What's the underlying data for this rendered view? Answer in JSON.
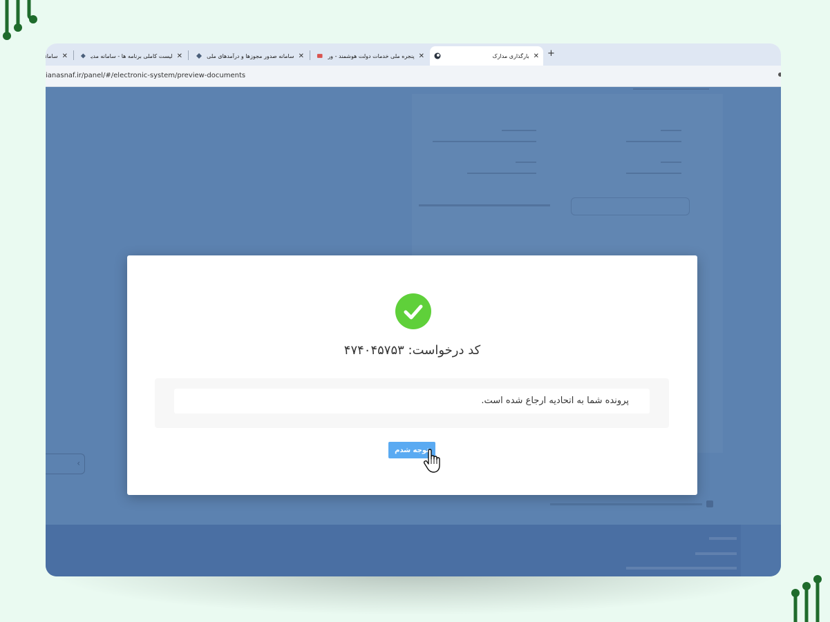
{
  "browser": {
    "tabs": [
      {
        "label": "بارگذاری مدارک",
        "active": true
      },
      {
        "label": "پنجره ملی خدمات دولت هوشمند - ورود",
        "active": false
      },
      {
        "label": "سامانه صدور مجوزها و درآمدهای ملی",
        "active": false
      },
      {
        "label": "لیست کاملی برنامه ها - سامانه مدیریت ا",
        "active": false
      },
      {
        "label": "سامانه",
        "active": false
      }
    ],
    "close_glyph": "✕",
    "new_tab_glyph": "+",
    "url": "ianasnaf.ir/panel/#/electronic-system/preview-documents"
  },
  "modal": {
    "request_code_label": "کد درخواست: ۴۷۴۰۴۵۷۵۳",
    "message": "پرونده شما به اتحادیه ارجاع شده است.",
    "ack_button_label": "توجه شدم"
  },
  "colors": {
    "page_background": "#eafaf1",
    "overlay_content": "#5c82b0",
    "success_green": "#5fd03a",
    "button_blue": "#5aaaf2",
    "logo_green": "#1f6b2c"
  },
  "icons": {
    "success": "check-circle-icon",
    "cursor": "hand-pointer-icon",
    "logo": "circuit-logo-icon"
  }
}
